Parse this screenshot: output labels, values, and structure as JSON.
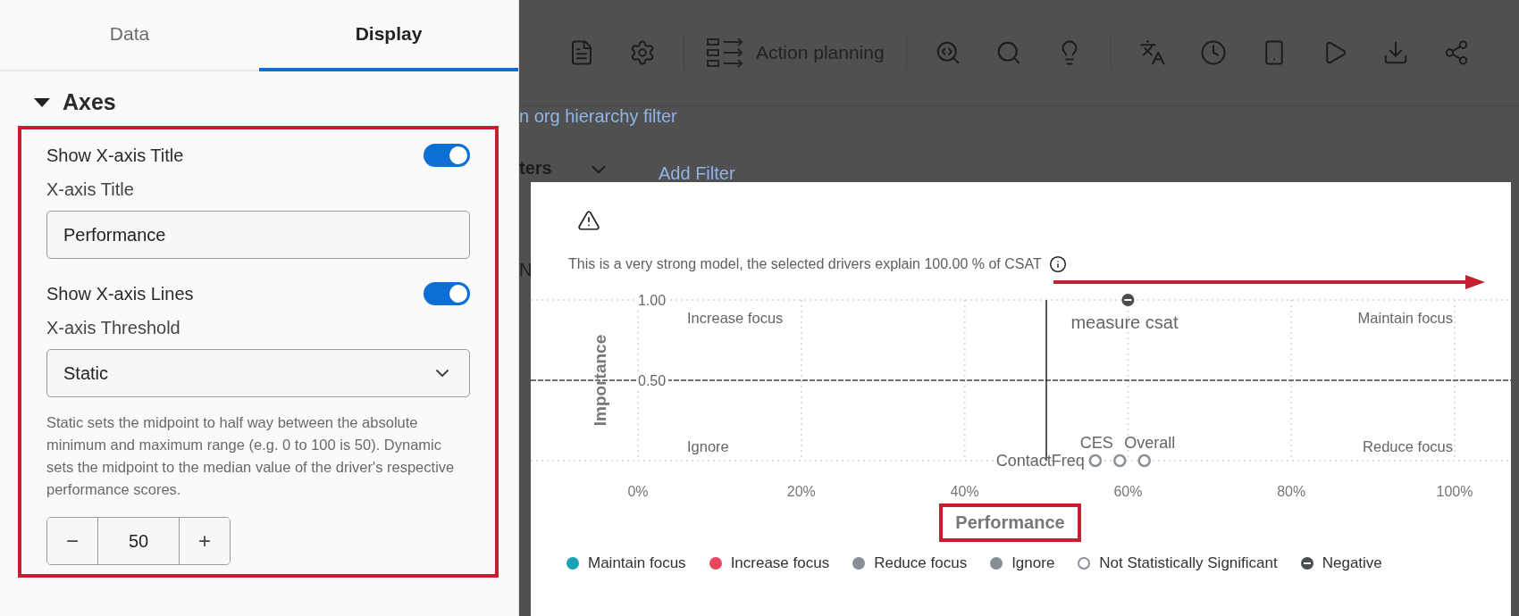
{
  "panel": {
    "tabs": [
      {
        "label": "Data",
        "selected": false
      },
      {
        "label": "Display",
        "selected": true
      }
    ],
    "section": {
      "title": "Axes",
      "expanded": true,
      "highlighted": true,
      "controls": [
        {
          "kind": "toggle",
          "label": "Show X-axis Title",
          "on": true
        },
        {
          "kind": "text_field",
          "label": "X-axis Title",
          "value": "Performance"
        },
        {
          "kind": "toggle",
          "label": "Show X-axis Lines",
          "on": true
        },
        {
          "kind": "select",
          "label": "X-axis Threshold",
          "value": "Static"
        },
        {
          "kind": "help",
          "text": "Static sets the midpoint to half way between the absolute minimum and maximum range (e.g. 0 to 100 is 50). Dynamic sets the midpoint to the median value of the driver's respective performance scores."
        },
        {
          "kind": "stepper",
          "minus": "−",
          "value": "50",
          "plus": "+"
        }
      ]
    }
  },
  "toolbar": {
    "items": [
      {
        "kind": "icon"
      },
      {
        "kind": "icon"
      },
      {
        "kind": "divider"
      },
      {
        "kind": "button",
        "label": "Action planning"
      },
      {
        "kind": "divider"
      },
      {
        "kind": "icon"
      },
      {
        "kind": "icon"
      },
      {
        "kind": "icon"
      },
      {
        "kind": "divider"
      },
      {
        "kind": "icon"
      },
      {
        "kind": "icon"
      },
      {
        "kind": "icon"
      },
      {
        "kind": "icon"
      },
      {
        "kind": "icon"
      },
      {
        "kind": "icon"
      }
    ]
  },
  "page": {
    "link": "n org hierarchy filter",
    "filters_label": "ters",
    "add_filter": "Add Filter",
    "tab_fragment": "N"
  },
  "modal": {
    "message": "This is a very strong model, the selected drivers explain 100.00 % of CSAT",
    "chart_data": {
      "type": "scatter",
      "xlabel": "Performance",
      "ylabel": "Importance",
      "xlim": [
        0,
        1
      ],
      "ylim": [
        0,
        1
      ],
      "grid": true,
      "xticks": [
        {
          "value": 0,
          "label": "0%"
        },
        {
          "value": 0.2,
          "label": "20%"
        },
        {
          "value": 0.4,
          "label": "40%"
        },
        {
          "value": 0.6,
          "label": "60%"
        },
        {
          "value": 0.8,
          "label": "80%"
        },
        {
          "value": 1,
          "label": "100%"
        }
      ],
      "yticks": [
        {
          "value": 1,
          "label": "1.00"
        },
        {
          "value": 0.5,
          "label": "0.50"
        }
      ],
      "ref_lines": [
        {
          "axis": "y",
          "value": 0.5
        },
        {
          "axis": "x",
          "value": 0.5
        }
      ],
      "legend": "bottom",
      "series": [
        {
          "name": "Maintain focus",
          "color": "#1aa3b4"
        },
        {
          "name": "Increase focus",
          "color": "#e5485e"
        },
        {
          "name": "Reduce focus",
          "color": "#878e98"
        },
        {
          "name": "Ignore",
          "color": "#878e98"
        },
        {
          "name": "Not Statistically Significant",
          "color": "#8a9099",
          "x": [
            0.56,
            0.59,
            0.62
          ],
          "values": [
            0,
            0,
            0
          ]
        },
        {
          "name": "Negative",
          "color": "#4a4d52",
          "x": [
            0.6
          ],
          "values": [
            1
          ]
        }
      ],
      "annotations": [
        "Increase focus",
        "Maintain focus",
        "Ignore",
        "Reduce focus",
        {
          "text": "measure csat",
          "x": 0.6,
          "y": 1
        },
        {
          "text": "ContactFreq",
          "x": 0.56,
          "y": 0
        },
        {
          "text": "CES",
          "x": 0.59,
          "y": 0
        },
        {
          "text": "Overall",
          "x": 0.62,
          "y": 0
        }
      ]
    },
    "legend_markers": [
      {
        "kind": "filled"
      },
      {
        "kind": "filled"
      },
      {
        "kind": "filled"
      },
      {
        "kind": "filled"
      },
      {
        "kind": "hollow"
      },
      {
        "kind": "negative"
      }
    ],
    "xlabel_highlighted": true,
    "arrow": true
  }
}
